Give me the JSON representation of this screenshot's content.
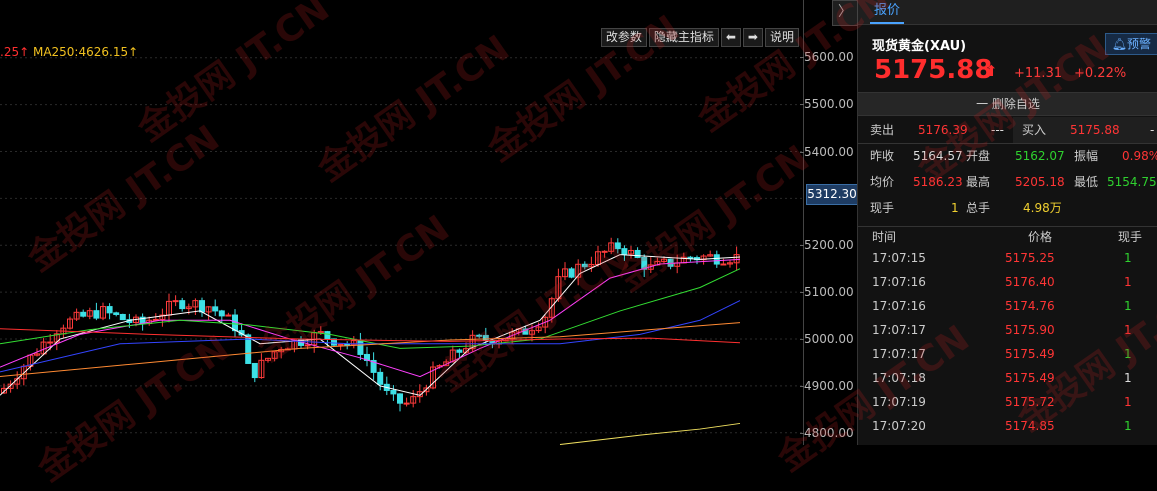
{
  "chart": {
    "ma_legend_prefix": ".25↑",
    "ma_legend_main": "MA250:4626.15↑",
    "toolbar": {
      "params": "改参数",
      "hide_main": "隐藏主指标",
      "left": "⬅",
      "right": "➡",
      "help": "说明"
    },
    "y_ticks": [
      "5600.00",
      "5500.00",
      "5400.00",
      "5200.00",
      "5100.00",
      "5000.00",
      "4900.00",
      "4800.00"
    ],
    "current_price_tag": "5312.30",
    "watermark": "金投网 JT.CN"
  },
  "panel": {
    "collapse_glyph": "〉",
    "tab": "报价",
    "instrument": "现货黄金(XAU)",
    "alert_label": "预警",
    "price": "5175.88",
    "arrow": "⬆",
    "change": "+11.31",
    "change_pct": "+0.22%",
    "watch_button": "一 删除自选",
    "sell_label": "卖出",
    "sell_value": "5176.39",
    "sell_vol": "---",
    "buy_label": "买入",
    "buy_value": "5175.88",
    "buy_vol": "-",
    "stats": [
      {
        "l1": "昨收",
        "v1": "5164.57",
        "l2": "开盘",
        "v2": "5162.07",
        "l3": "振幅",
        "v3": "0.98%"
      },
      {
        "l1": "均价",
        "v1": "5186.23",
        "l2": "最高",
        "v2": "5205.18",
        "l3": "最低",
        "v3": "5154.75"
      },
      {
        "l1": "现手",
        "v1": "1",
        "l2": "总手",
        "v2": "4.98万"
      }
    ],
    "trades_header": {
      "time": "时间",
      "price": "价格",
      "vol": "现手"
    },
    "trades": [
      {
        "time": "17:07:15",
        "price": "5175.25",
        "vol": "1",
        "color": "green"
      },
      {
        "time": "17:07:16",
        "price": "5176.40",
        "vol": "1",
        "color": "red"
      },
      {
        "time": "17:07:16",
        "price": "5174.76",
        "vol": "1",
        "color": "green"
      },
      {
        "time": "17:07:17",
        "price": "5175.90",
        "vol": "1",
        "color": "red"
      },
      {
        "time": "17:07:17",
        "price": "5175.49",
        "vol": "1",
        "color": "green"
      },
      {
        "time": "17:07:18",
        "price": "5175.49",
        "vol": "1",
        "color": "white"
      },
      {
        "time": "17:07:19",
        "price": "5175.72",
        "vol": "1",
        "color": "red"
      },
      {
        "time": "17:07:20",
        "price": "5174.85",
        "vol": "1",
        "color": "green"
      }
    ]
  }
}
